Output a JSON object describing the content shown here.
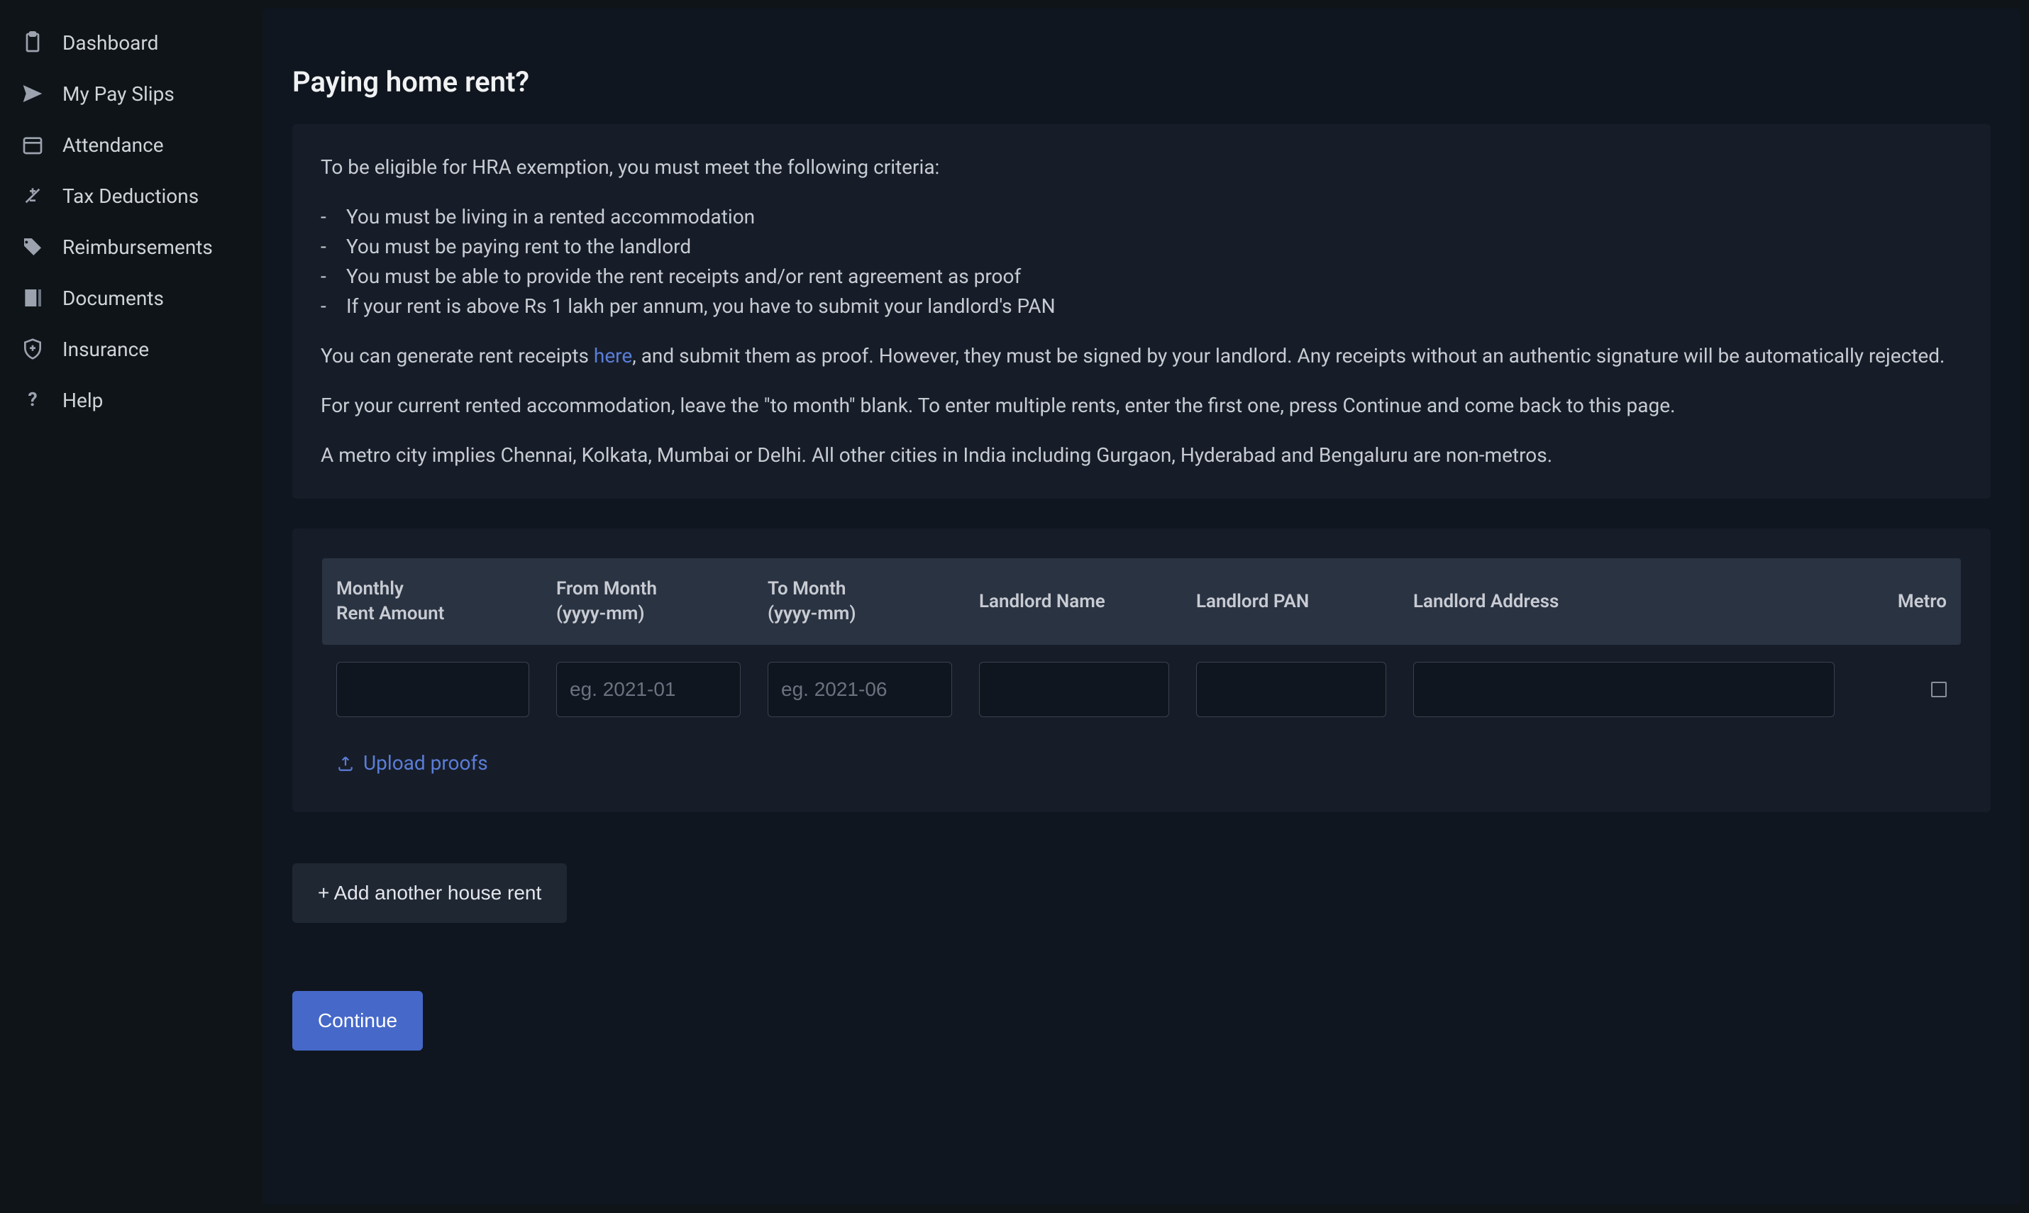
{
  "sidebar": {
    "items": [
      {
        "label": "Dashboard",
        "icon": "clipboard"
      },
      {
        "label": "My Pay Slips",
        "icon": "send"
      },
      {
        "label": "Attendance",
        "icon": "calendar"
      },
      {
        "label": "Tax Deductions",
        "icon": "adjust"
      },
      {
        "label": "Reimbursements",
        "icon": "tag"
      },
      {
        "label": "Documents",
        "icon": "document"
      },
      {
        "label": "Insurance",
        "icon": "shield"
      },
      {
        "label": "Help",
        "icon": "help"
      }
    ]
  },
  "page": {
    "title": "Paying home rent?"
  },
  "info": {
    "intro": "To be eligible for HRA exemption, you must meet the following criteria:",
    "criteria": [
      "You must be living in a rented accommodation",
      "You must be paying rent to the landlord",
      "You must be able to provide the rent receipts and/or rent agreement as proof",
      "If your rent is above Rs 1 lakh per annum, you have to submit your landlord's PAN"
    ],
    "receipts_pre": "You can generate rent receipts ",
    "receipts_link": "here",
    "receipts_post": ", and submit them as proof. However, they must be signed by your landlord. Any receipts without an authentic signature will be automatically rejected.",
    "current_accommodation": "For your current rented accommodation, leave the \"to month\" blank. To enter multiple rents, enter the first one, press Continue and come back to this page.",
    "metro_note": "A metro city implies Chennai, Kolkata, Mumbai or Delhi. All other cities in India including Gurgaon, Hyderabad and Bengaluru are non-metros."
  },
  "table": {
    "headers": {
      "amount_l1": "Monthly",
      "amount_l2": "Rent Amount",
      "from_l1": "From Month",
      "from_l2": "(yyyy-mm)",
      "to_l1": "To Month",
      "to_l2": "(yyyy-mm)",
      "lname": "Landlord Name",
      "lpan": "Landlord PAN",
      "laddr": "Landlord Address",
      "metro": "Metro"
    },
    "placeholders": {
      "from": "eg. 2021-01",
      "to": "eg. 2021-06"
    },
    "upload_label": "Upload proofs"
  },
  "actions": {
    "add_rent": "+ Add another house rent",
    "continue": "Continue"
  }
}
